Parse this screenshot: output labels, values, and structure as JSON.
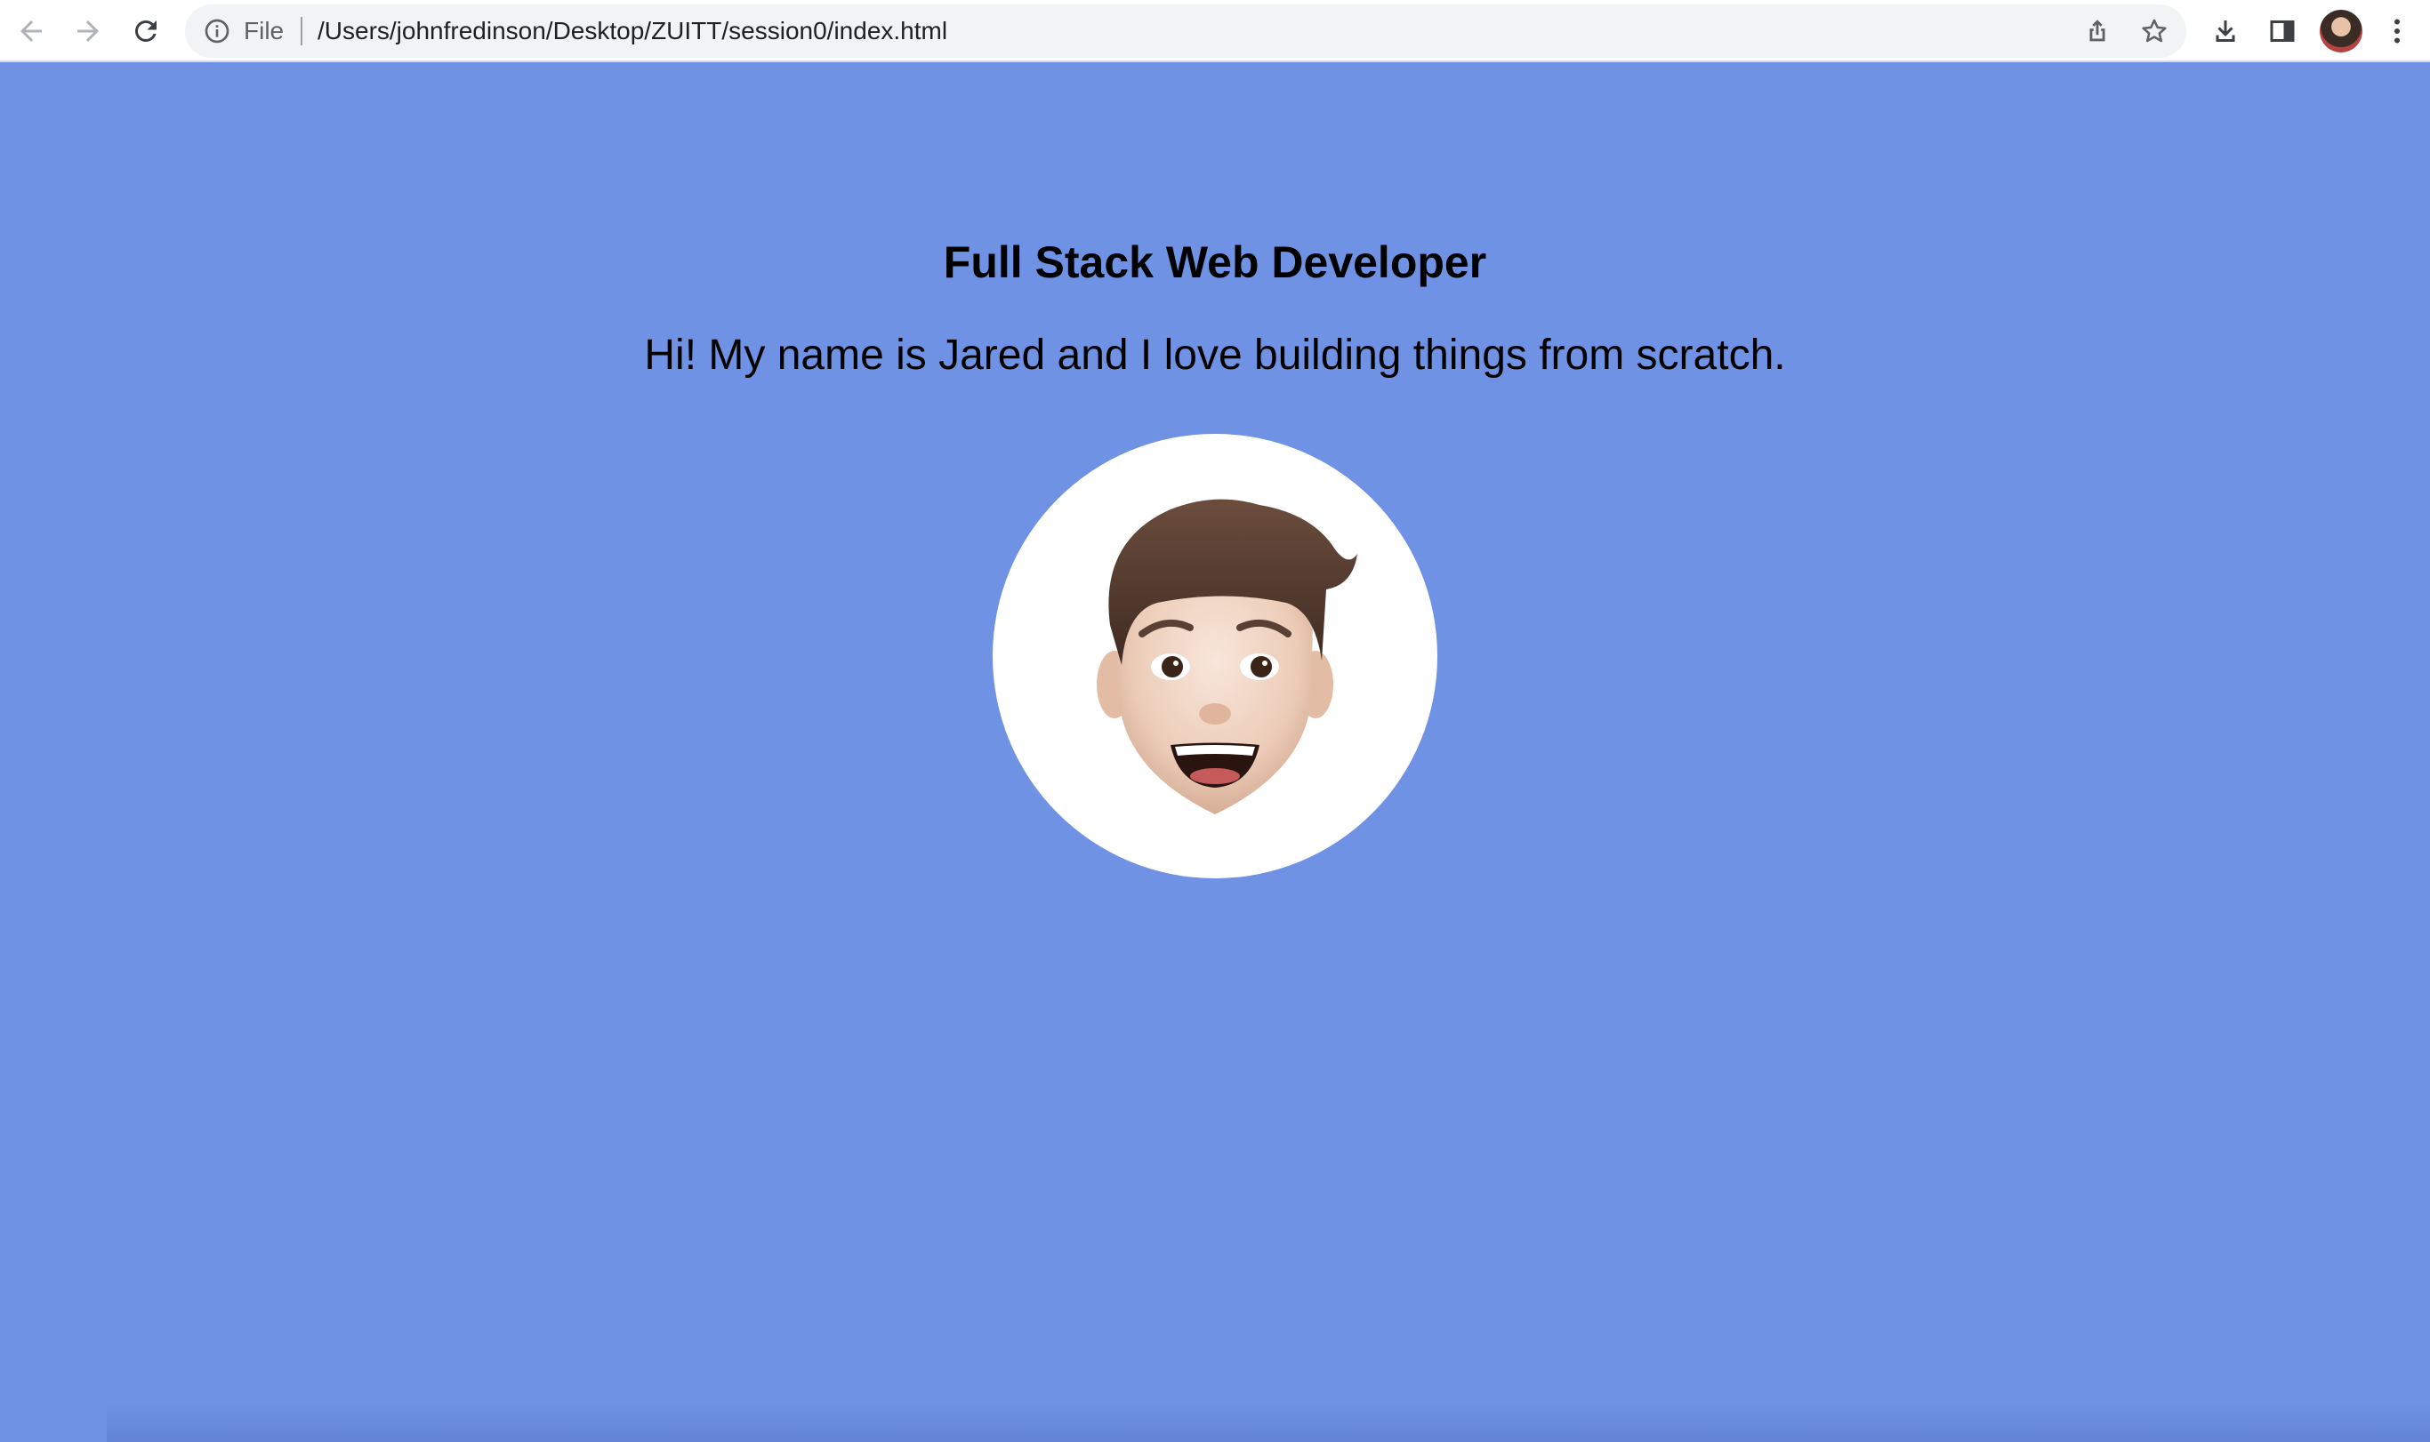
{
  "browser": {
    "nav": {
      "back_icon": "arrow-left-icon",
      "forward_icon": "arrow-right-icon",
      "reload_icon": "reload-icon"
    },
    "omnibox": {
      "info_icon": "info-circle-icon",
      "scheme_label": "File",
      "url": "/Users/johnfredinson/Desktop/ZUITT/session0/index.html",
      "share_icon": "share-icon",
      "bookmark_icon": "star-icon"
    },
    "actions": {
      "download_icon": "download-icon",
      "side_panel_icon": "side-panel-icon",
      "profile_icon": "profile-avatar",
      "menu_icon": "kebab-menu-icon"
    }
  },
  "page": {
    "background_color": "#6f92e4",
    "headline": "Full Stack Web Developer",
    "intro": "Hi! My name is Jared and I love building things from scratch.",
    "portrait_icon": "memoji-avatar"
  }
}
